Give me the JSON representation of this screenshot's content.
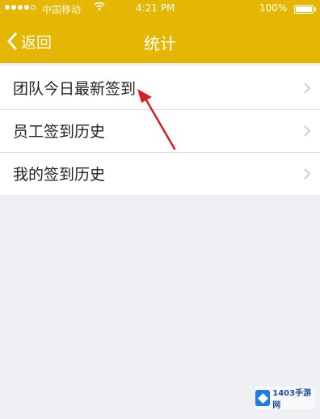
{
  "status_bar": {
    "carrier": "中国移动",
    "time": "4:21 PM",
    "battery": "100%",
    "battery_level": 1.0,
    "signal_bars": 4
  },
  "nav": {
    "back_label": "返回",
    "title": "统计"
  },
  "menu": {
    "items": [
      {
        "label": "团队今日最新签到"
      },
      {
        "label": "员工签到历史"
      },
      {
        "label": "我的签到历史"
      }
    ]
  },
  "colors": {
    "nav_background": "#e5b703",
    "page_background": "#efeff4",
    "annotation_arrow": "#d42020"
  },
  "icons": {
    "back": "chevron-left-icon",
    "row_disclosure": "chevron-right-icon",
    "wifi": "wifi-icon",
    "battery": "battery-icon"
  },
  "watermark": {
    "text": "1403手游网"
  }
}
